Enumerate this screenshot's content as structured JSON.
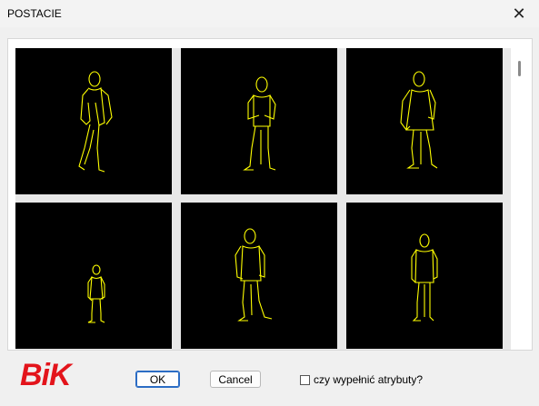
{
  "window": {
    "title": "POSTACIE"
  },
  "gallery": {
    "items": [
      {
        "name": "figure-1"
      },
      {
        "name": "figure-2"
      },
      {
        "name": "figure-3"
      },
      {
        "name": "figure-4"
      },
      {
        "name": "figure-5"
      },
      {
        "name": "figure-6"
      }
    ]
  },
  "footer": {
    "logo": "BiK",
    "ok_label": "OK",
    "cancel_label": "Cancel",
    "checkbox_label": "czy wypełnić atrybuty?",
    "checkbox_checked": false
  },
  "colors": {
    "figure_stroke": "#ffff00",
    "tile_bg": "#000000",
    "logo": "#e3141b"
  }
}
